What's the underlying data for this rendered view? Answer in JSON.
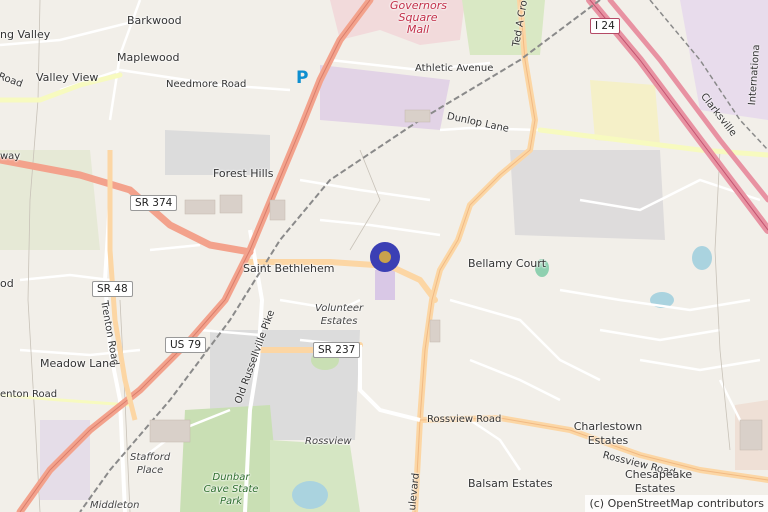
{
  "map": {
    "labels": {
      "barkwood": "Barkwood",
      "spring_valley": "ng Valley",
      "maplewood": "Maplewood",
      "valley_view": "Valley View",
      "needmore_road": "Needmore Road",
      "governors_square": "Governors Square Mall",
      "athletic_avenue": "Athletic Avenue",
      "dunlop_lane": "Dunlop Lane",
      "ted_a_crozier": "Ted A Cro",
      "clarksville": "Clarksville",
      "international": "Internationa",
      "forest_hills": "Forest Hills",
      "saint_bethlehem": "Saint Bethlehem",
      "bellamy_court": "Bellamy Court",
      "volunteer_estates": "Volunteer Estates",
      "trenton_road": "Trenton Road",
      "meadow_lane": "Meadow Lane",
      "old_russellville_pike": "Old Russellville Pike",
      "trenton_road_west": "enton Road",
      "rossview_road": "Rossview Road",
      "rossview_road_east": "Rossview Road",
      "rossview": "Rossview",
      "charlestown_estates": "Charlestown Estates",
      "chesapeake_estates": "Chesapeake Estates",
      "stafford_place": "Stafford Place",
      "dunbar_cave": "Dunbar Cave State Park",
      "balsam_estates": "Balsam Estates",
      "middleton": "Middleton",
      "boulevard": "ulevard",
      "way": "way",
      "od": "od",
      "road_left": "Road"
    },
    "shields": {
      "i24": "I 24",
      "sr374": "SR 374",
      "sr48": "SR 48",
      "us79": "US 79",
      "sr237": "SR 237"
    },
    "parking_symbol": "P",
    "attribution": "(c) OpenStreetMap contributors",
    "marker": "location-marker"
  }
}
